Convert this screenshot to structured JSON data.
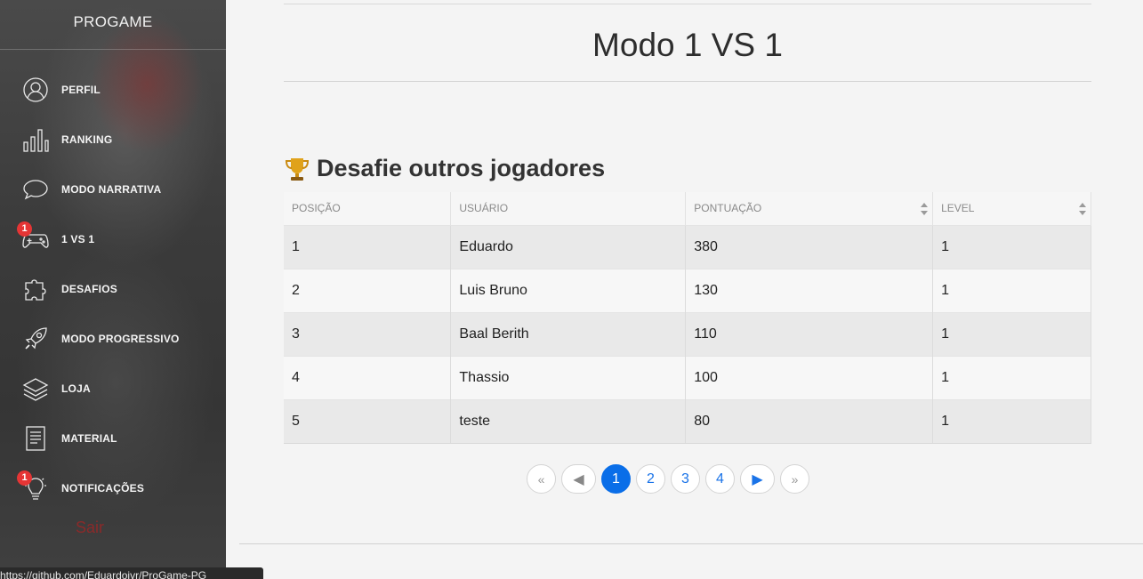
{
  "brand": "PROGAME",
  "sidebar": {
    "items": [
      {
        "label": "PERFIL",
        "icon": "user-circle-icon",
        "badge": ""
      },
      {
        "label": "RANKING",
        "icon": "bar-chart-icon",
        "badge": ""
      },
      {
        "label": "MODO NARRATIVA",
        "icon": "speech-bubble-icon",
        "badge": ""
      },
      {
        "label": "1 VS 1",
        "icon": "gamepad-icon",
        "badge": "1"
      },
      {
        "label": "DESAFIOS",
        "icon": "puzzle-icon",
        "badge": ""
      },
      {
        "label": "MODO PROGRESSIVO",
        "icon": "rocket-icon",
        "badge": ""
      },
      {
        "label": "LOJA",
        "icon": "layers-icon",
        "badge": ""
      },
      {
        "label": "MATERIAL",
        "icon": "document-icon",
        "badge": ""
      },
      {
        "label": "NOTIFICAÇÕES",
        "icon": "lightbulb-icon",
        "badge": "1"
      }
    ],
    "logout": "Sair"
  },
  "main": {
    "title": "Modo 1 VS 1",
    "section_title": "Desafie outros jogadores",
    "table": {
      "headers": [
        "POSIÇÃO",
        "USUÁRIO",
        "PONTUAÇÃO",
        "LEVEL"
      ],
      "rows": [
        [
          "1",
          "Eduardo",
          "380",
          "1"
        ],
        [
          "2",
          "Luis Bruno",
          "130",
          "1"
        ],
        [
          "3",
          "Baal Berith",
          "110",
          "1"
        ],
        [
          "4",
          "Thassio",
          "100",
          "1"
        ],
        [
          "5",
          "teste",
          "80",
          "1"
        ]
      ]
    },
    "pagination": {
      "first": "«",
      "prev": "◀",
      "pages": [
        "1",
        "2",
        "3",
        "4"
      ],
      "current": "1",
      "next": "▶",
      "last": "»"
    }
  },
  "status_url": "https://github.com/Eduardojvr/ProGame-PG",
  "colors": {
    "accent": "#0a6ee8",
    "badge": "#e53535",
    "logout": "#8a2a2a"
  }
}
